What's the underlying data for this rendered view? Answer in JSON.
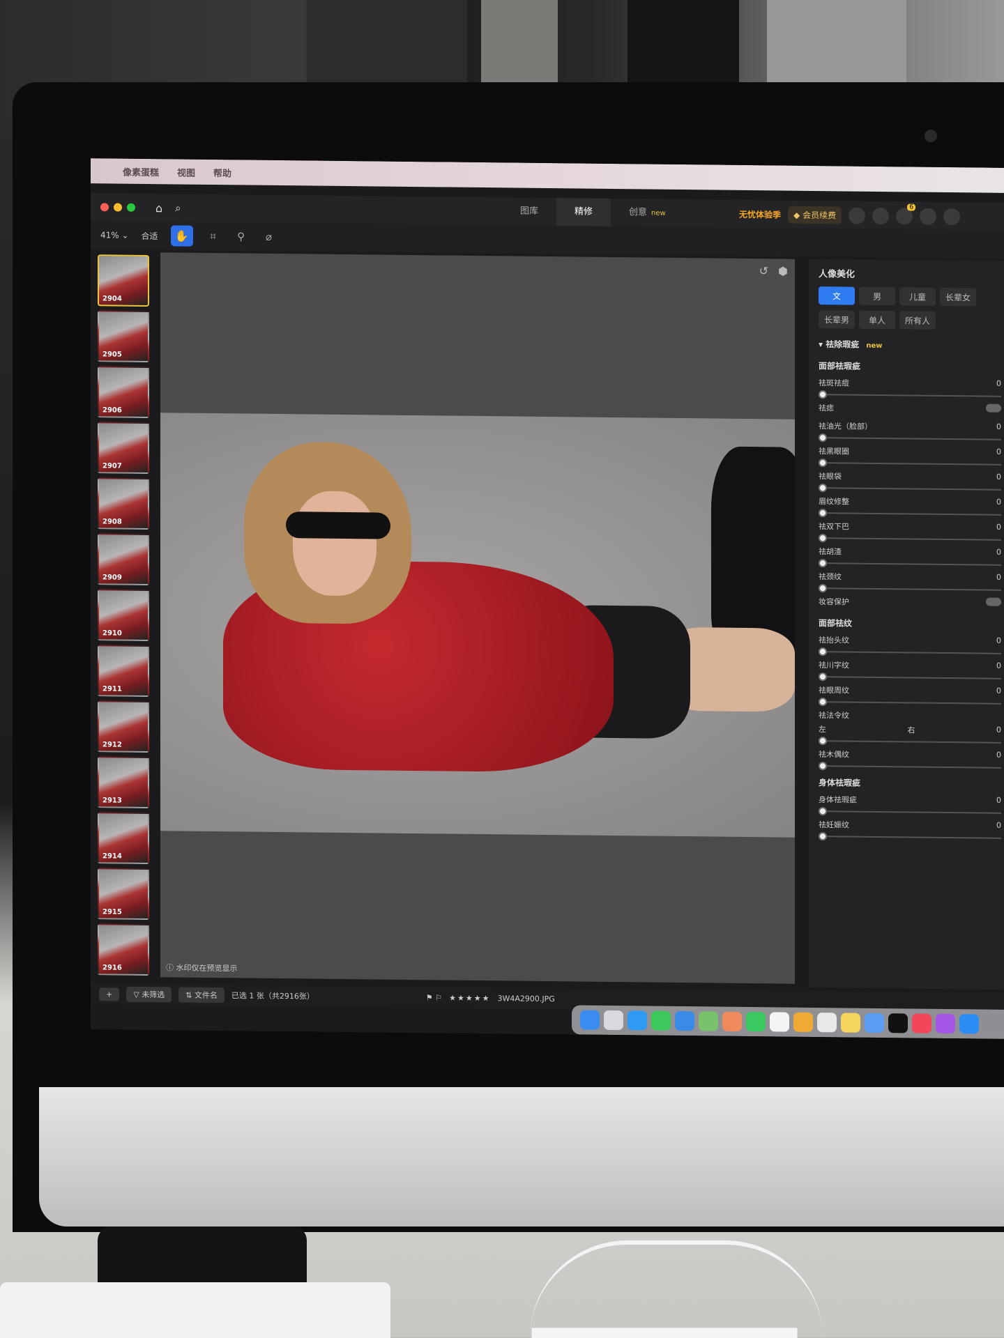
{
  "menubar": {
    "app_name": "像素蛋糕",
    "items": [
      "视图",
      "帮助"
    ]
  },
  "header": {
    "tabs": [
      {
        "label": "图库"
      },
      {
        "label": "精修"
      },
      {
        "label": "创意",
        "badge": "new"
      }
    ],
    "promo": "无忧体验季",
    "vip_button": "会员续费",
    "notification_count": "6"
  },
  "toolbar": {
    "zoom": "41%",
    "fit": "合适"
  },
  "filmstrip": {
    "thumbs": [
      "2904",
      "2905",
      "2906",
      "2907",
      "2908",
      "2909",
      "2910",
      "2911",
      "2912",
      "2913",
      "2914",
      "2915",
      "2916"
    ]
  },
  "canvas": {
    "watermark_note": "水印仅在预览显示"
  },
  "statusbar": {
    "filter_label": "未筛选",
    "sort_label": "文件名",
    "selection": "已选 1 张（共2916张）",
    "filename": "3W4A2900.JPG"
  },
  "panel": {
    "title": "人像美化",
    "gender_tabs": [
      "文",
      "男",
      "儿童",
      "长辈女"
    ],
    "group_tabs": [
      "长辈男",
      "单人",
      "所有人"
    ],
    "section_main": "祛除瑕疵",
    "section_main_badge": "new",
    "face_blemish_head": "面部祛瑕疵",
    "face_sliders": [
      {
        "label": "祛斑祛痘",
        "value": "0"
      },
      {
        "label": "祛痣",
        "value": ""
      },
      {
        "label": "祛油光（脸部）",
        "value": "0"
      },
      {
        "label": "祛黑眼圈",
        "value": "0"
      },
      {
        "label": "祛眼袋",
        "value": "0"
      },
      {
        "label": "眉纹修整",
        "value": "0"
      },
      {
        "label": "祛双下巴",
        "value": "0"
      },
      {
        "label": "祛胡渣",
        "value": "0"
      },
      {
        "label": "祛颈纹",
        "value": "0"
      }
    ],
    "makeup_protect": "妆容保护",
    "wrinkle_head": "面部祛纹",
    "wrinkle_sliders": [
      {
        "label": "祛抬头纹",
        "value": "0"
      },
      {
        "label": "祛川字纹",
        "value": "0"
      },
      {
        "label": "祛眼周纹",
        "value": "0"
      },
      {
        "label": "祛法令纹",
        "value": "0"
      },
      {
        "label": "祛木偶纹",
        "value": "0"
      }
    ],
    "left_label": "左",
    "right_label": "右",
    "body_head": "身体祛瑕疵",
    "body_sliders": [
      {
        "label": "身体祛瑕疵",
        "value": "0"
      },
      {
        "label": "祛妊娠纹",
        "value": "0"
      }
    ]
  }
}
